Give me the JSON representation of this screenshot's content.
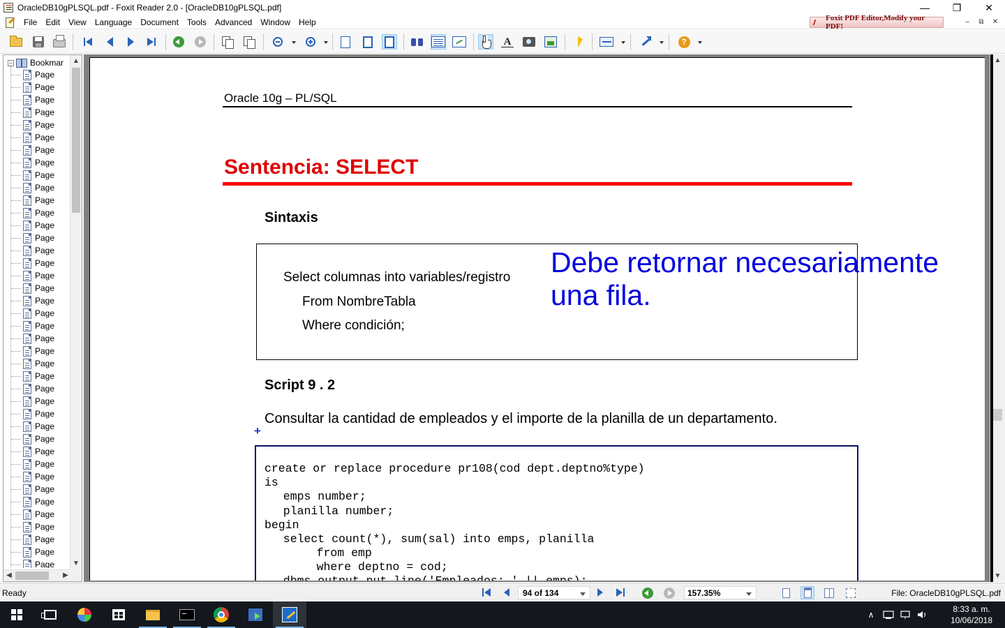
{
  "window": {
    "title": "OracleDB10gPLSQL.pdf - Foxit Reader 2.0 - [OracleDB10gPLSQL.pdf]",
    "minimize": "—",
    "restore": "❐",
    "close": "✕"
  },
  "menu": {
    "items": [
      "File",
      "Edit",
      "View",
      "Language",
      "Document",
      "Tools",
      "Advanced",
      "Window",
      "Help"
    ],
    "promo": "Foxit PDF Editor,Modify your PDF!",
    "child_min": "–",
    "child_restore": "⧉",
    "child_close": "✕"
  },
  "bookmarks": {
    "root_label": "Bookmar",
    "items": [
      "Page",
      "Page",
      "Page",
      "Page",
      "Page",
      "Page",
      "Page",
      "Page",
      "Page",
      "Page",
      "Page",
      "Page",
      "Page",
      "Page",
      "Page",
      "Page",
      "Page",
      "Page",
      "Page",
      "Page",
      "Page",
      "Page",
      "Page",
      "Page",
      "Page",
      "Page",
      "Page",
      "Page",
      "Page",
      "Page",
      "Page",
      "Page",
      "Page",
      "Page",
      "Page",
      "Page",
      "Page",
      "Page",
      "Page",
      "Page"
    ]
  },
  "document": {
    "header": "Oracle 10g – PL/SQL",
    "title": "Sentencia: SELECT",
    "syntax_heading": "Sintaxis",
    "syntax_lines": [
      "Select columnas into variables/registro",
      "From NombreTabla",
      "Where condición;"
    ],
    "annotation_lines": [
      "Debe retornar necesariamente",
      "una fila."
    ],
    "script_heading": "Script 9 . 2",
    "script_description": "Consultar la cantidad de empleados y el importe de la planilla de un departamento.",
    "code_lines": [
      "create or replace procedure pr108(cod dept.deptno%type)",
      "is",
      "  emps number;",
      "  planilla number;",
      "begin",
      "  select count(*), sum(sal) into emps, planilla",
      "    from emp",
      "    where deptno = cod;",
      "  dbms_output.put_line('Empleados: ' || emps);"
    ],
    "colors": {
      "title_red": "#e00000",
      "annotation_blue": "#0000dd",
      "code_border": "#0c1466"
    }
  },
  "statusbar": {
    "status": "Ready",
    "page_display": "94 of 134",
    "zoom": "157.35%",
    "file": "File: OracleDB10gPLSQL.pdf"
  },
  "taskbar": {
    "clock_time": "8:33 a. m.",
    "clock_date": "10/06/2018",
    "tray_chevron": "∧"
  }
}
